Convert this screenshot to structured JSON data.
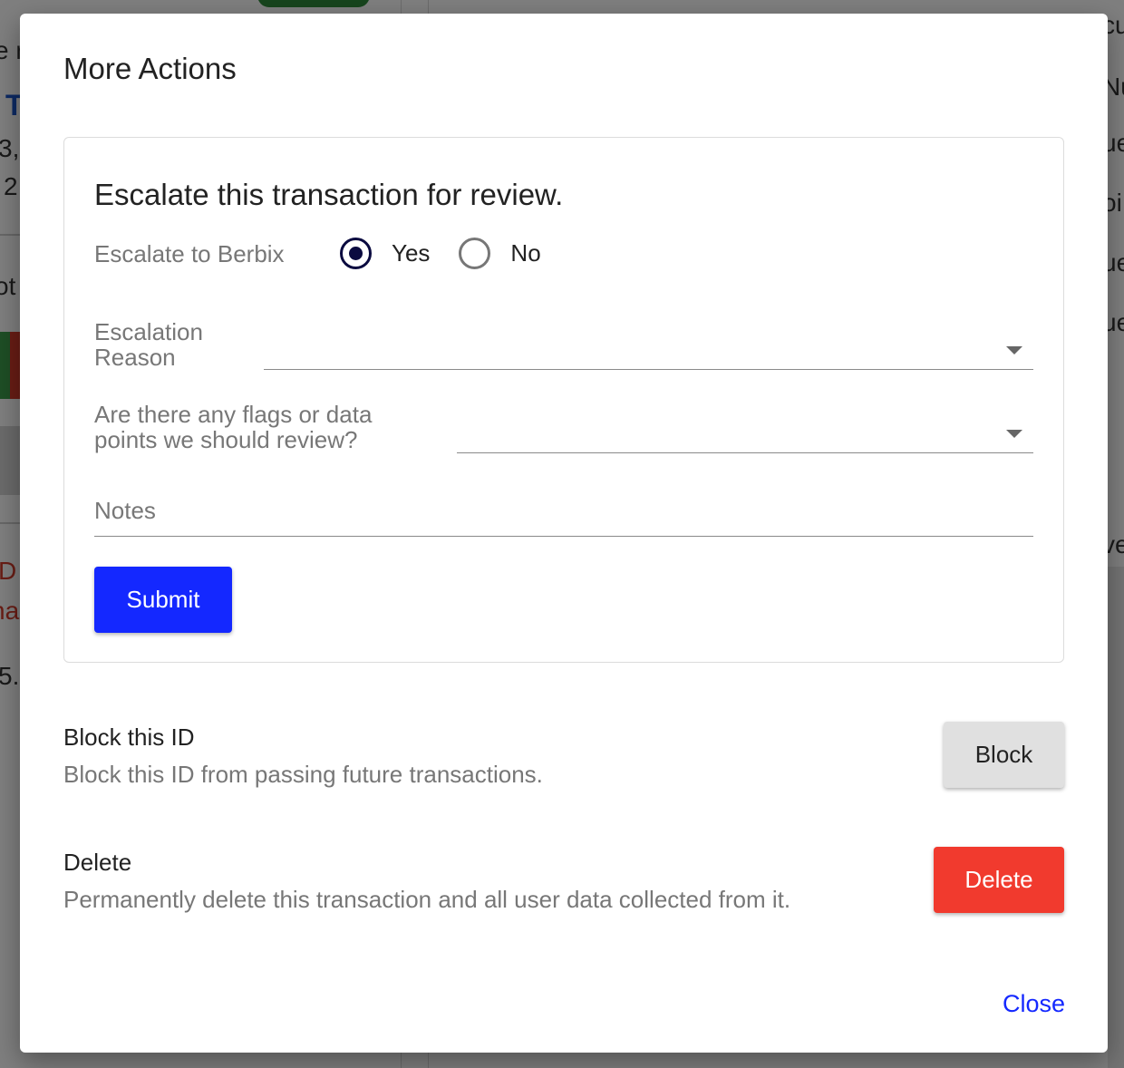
{
  "background": {
    "fragments": [
      "e r",
      "T",
      "3,",
      "2",
      "ot",
      "D",
      "na",
      "5.",
      "cu",
      "Nu",
      "ue",
      "oi",
      "ue",
      "ue",
      "ve"
    ]
  },
  "modal": {
    "title": "More Actions",
    "escalate": {
      "heading": "Escalate this transaction for review.",
      "escalate_label": "Escalate to Berbix",
      "radio_yes": "Yes",
      "radio_no": "No",
      "selected": "Yes",
      "reason_label_line1": "Escalation",
      "reason_label_line2": "Reason",
      "reason_value": "",
      "flags_label_line1": "Are there any flags or data",
      "flags_label_line2": "points we should review?",
      "flags_value": "",
      "notes_placeholder": "Notes",
      "submit_label": "Submit"
    },
    "block": {
      "title": "Block this ID",
      "description": "Block this ID from passing future transactions.",
      "button_label": "Block"
    },
    "delete": {
      "title": "Delete",
      "description": "Permanently delete this transaction and all user data collected from it.",
      "button_label": "Delete"
    },
    "close_label": "Close"
  },
  "colors": {
    "primary": "#1428ff",
    "danger": "#f13a2e",
    "neutral_button": "#e0e0e0",
    "radio_selected": "#0b0b40"
  }
}
